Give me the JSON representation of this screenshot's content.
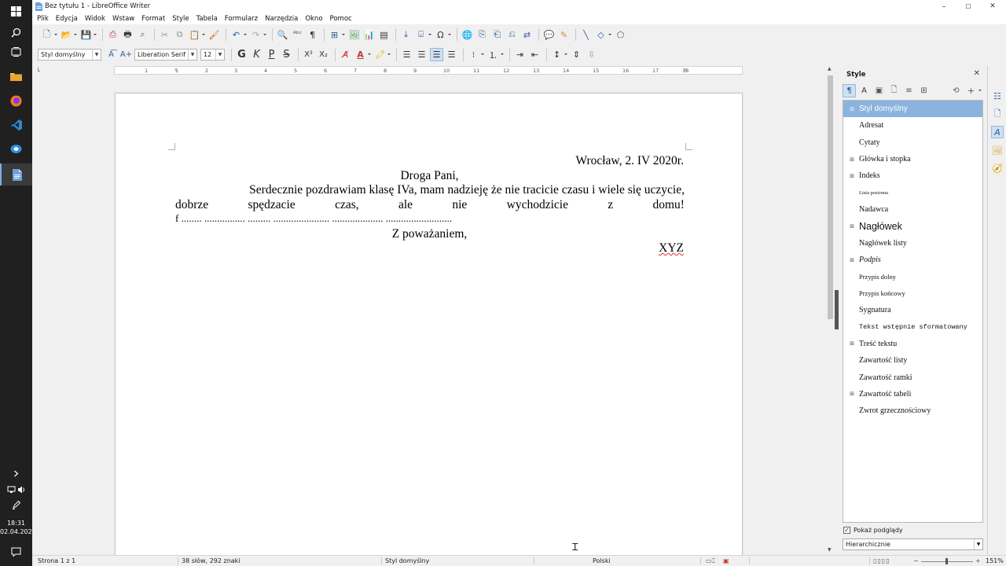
{
  "window": {
    "title": "Bez tytułu 1 - LibreOffice Writer",
    "minimize": "–",
    "maximize": "☐",
    "close": "✕"
  },
  "menu": [
    "Plik",
    "Edycja",
    "Widok",
    "Wstaw",
    "Format",
    "Style",
    "Tabela",
    "Formularz",
    "Narzędzia",
    "Okno",
    "Pomoc"
  ],
  "format_toolbar": {
    "paragraph_style": "Styl domyślny",
    "font_name": "Liberation Serif",
    "font_size": "12",
    "bold": "G",
    "italic": "K",
    "underline": "P",
    "strike": "S",
    "superscript": "X²",
    "subscript": "X₂"
  },
  "ruler": {
    "numbers": [
      "1",
      "1",
      "2",
      "3",
      "4",
      "5",
      "6",
      "7",
      "8",
      "9",
      "10",
      "11",
      "12",
      "13",
      "14",
      "15",
      "16",
      "17",
      "18"
    ]
  },
  "document": {
    "line1": "Wrocław, 2. IV 2020r.",
    "line2": "Droga Pani,",
    "line3": "Serdecznie pozdrawiam klasę IVa, mam nadzieję że nie tracicie czasu i wiele się uczycie,",
    "line4_words": [
      "dobrze",
      "spędzacie",
      "czas,",
      "ale",
      "nie",
      "wychodzicie",
      "z",
      "domu!"
    ],
    "line5": "f  ........ ................ ......... ...................... .................... ..........................",
    "line6": "Z poważaniem,",
    "line7": "XYZ"
  },
  "styles_panel": {
    "title": "Style",
    "close": "✕",
    "items": [
      {
        "label": "Styl domyślny",
        "expander": "⊟",
        "selected": true
      },
      {
        "label": "Adresat",
        "expander": ""
      },
      {
        "label": "Cytaty",
        "expander": ""
      },
      {
        "label": "Główka i stopka",
        "expander": "⊞"
      },
      {
        "label": "Indeks",
        "expander": "⊞"
      },
      {
        "label": "Lista pozioma",
        "expander": ""
      },
      {
        "label": "Nadawca",
        "expander": ""
      },
      {
        "label": "Nagłówek",
        "expander": "⊞"
      },
      {
        "label": "Nagłówek listy",
        "expander": ""
      },
      {
        "label": "Podpis",
        "expander": "⊞"
      },
      {
        "label": "Przypis dolny",
        "expander": ""
      },
      {
        "label": "Przypis końcowy",
        "expander": ""
      },
      {
        "label": "Sygnatura",
        "expander": ""
      },
      {
        "label": "Tekst wstępnie sformatowany",
        "expander": ""
      },
      {
        "label": "Treść tekstu",
        "expander": "⊞"
      },
      {
        "label": "Zawartość listy",
        "expander": ""
      },
      {
        "label": "Zawartość ramki",
        "expander": ""
      },
      {
        "label": "Zawartość tabeli",
        "expander": "⊞"
      },
      {
        "label": "Zwrot grzecznościowy",
        "expander": ""
      }
    ],
    "show_previews_label": "Pokaż podglądy",
    "show_previews_check": "✓",
    "filter": "Hierarchicznie"
  },
  "status": {
    "page": "Strona 1 z 1",
    "words": "38 słów, 292 znaki",
    "style": "Styl domyślny",
    "language": "Polski",
    "zoom": "151%"
  },
  "taskbar": {
    "time": "18:31",
    "date": "02.04.2020"
  }
}
